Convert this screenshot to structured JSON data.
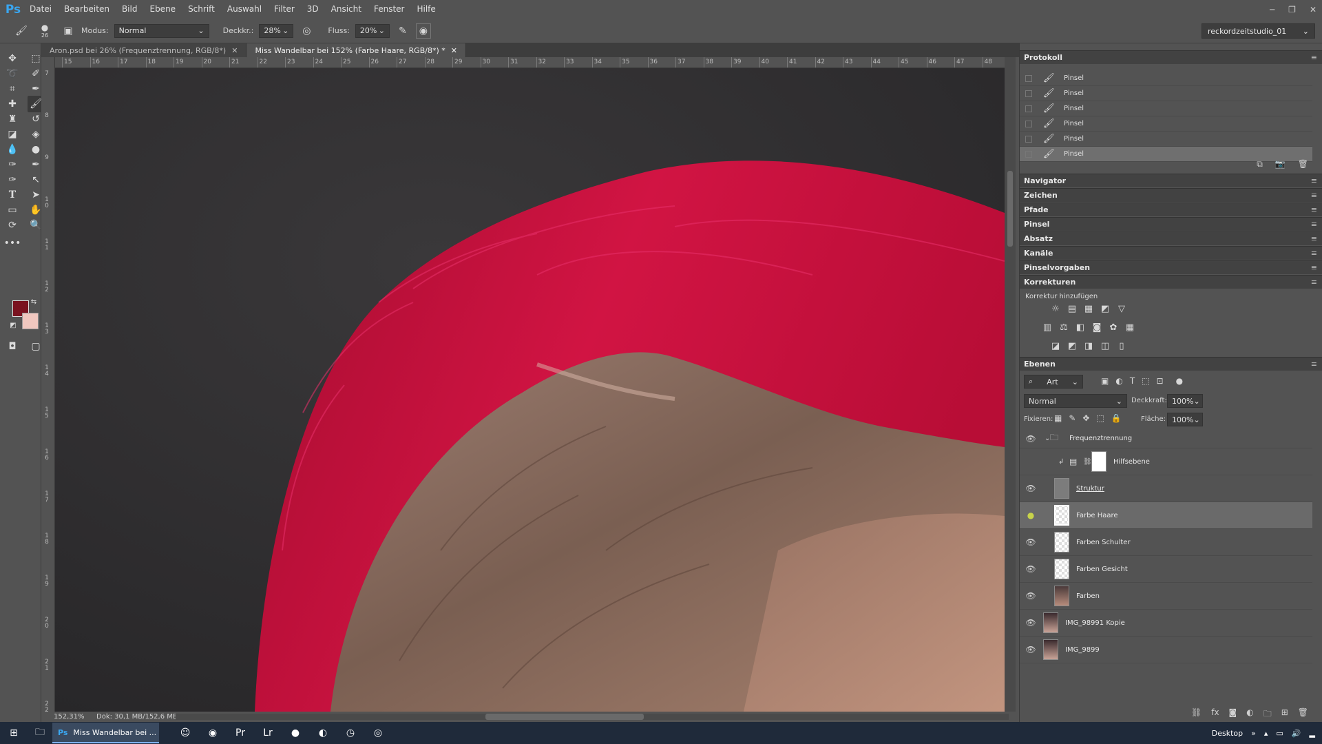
{
  "app": {
    "logo": "Ps"
  },
  "menu": [
    "Datei",
    "Bearbeiten",
    "Bild",
    "Ebene",
    "Schrift",
    "Auswahl",
    "Filter",
    "3D",
    "Ansicht",
    "Fenster",
    "Hilfe"
  ],
  "options": {
    "brush_size": "26",
    "modus_label": "Modus:",
    "modus_value": "Normal",
    "deckkraft_label": "Deckkr.:",
    "deckkraft_value": "28%",
    "fluss_label": "Fluss:",
    "fluss_value": "20%",
    "workspace": "reckordzeitstudio_01"
  },
  "tabs": [
    {
      "label": "Aron.psd bei 26% (Frequenztrennung, RGB/8*)",
      "active": false
    },
    {
      "label": "Miss Wandelbar bei 152% (Farbe Haare, RGB/8*) *",
      "active": true
    }
  ],
  "ruler_top": [
    "15",
    "16",
    "17",
    "18",
    "19",
    "20",
    "21",
    "22",
    "23",
    "24",
    "25",
    "26",
    "27",
    "28",
    "29",
    "30",
    "31",
    "32",
    "33",
    "34",
    "35",
    "36",
    "37",
    "38",
    "39",
    "40",
    "41",
    "42",
    "43",
    "44",
    "45",
    "46",
    "47",
    "48"
  ],
  "ruler_left": [
    "7",
    "8",
    "9",
    "1\n0",
    "1\n1",
    "1\n2",
    "1\n3",
    "1\n4",
    "1\n5",
    "1\n6",
    "1\n7",
    "1\n8",
    "1\n9",
    "2\n0",
    "2\n1",
    "2\n2"
  ],
  "status": {
    "zoom": "152,31%",
    "doc": "Dok: 30,1 MB/152,6 MB"
  },
  "panels": {
    "protokoll": "Protokoll",
    "history": [
      "Pinsel",
      "Pinsel",
      "Pinsel",
      "Pinsel",
      "Pinsel",
      "Pinsel"
    ],
    "collapsed": [
      "Navigator",
      "Zeichen",
      "Pfade",
      "Pinsel",
      "Absatz",
      "Kanäle",
      "Pinselvorgaben"
    ],
    "korrekturen": "Korrekturen",
    "korrektur_hinzufuegen": "Korrektur hinzufügen",
    "ebenen": "Ebenen"
  },
  "layers_panel": {
    "filter_label": "Art",
    "blend_mode": "Normal",
    "deckkraft_label": "Deckkraft:",
    "deckkraft_value": "100%",
    "fixieren_label": "Fixieren:",
    "flaeche_label": "Fläche:",
    "flaeche_value": "100%",
    "layers": [
      {
        "name": "Frequenztrennung",
        "type": "group"
      },
      {
        "name": "Hilfsebene",
        "type": "adjustment"
      },
      {
        "name": "Struktur",
        "type": "layer"
      },
      {
        "name": "Farbe Haare",
        "type": "layer",
        "selected": true
      },
      {
        "name": "Farben Schulter",
        "type": "layer"
      },
      {
        "name": "Farben Gesicht",
        "type": "layer"
      },
      {
        "name": "Farben",
        "type": "layer"
      },
      {
        "name": "IMG_98991 Kopie",
        "type": "layer"
      },
      {
        "name": "IMG_9899",
        "type": "layer"
      }
    ]
  },
  "taskbar": {
    "active_window": "Miss Wandelbar bei ...",
    "desktop": "Desktop"
  },
  "colors": {
    "foreground": "#7a1320",
    "background": "#f0c7bf",
    "hair": "#c8103c"
  }
}
